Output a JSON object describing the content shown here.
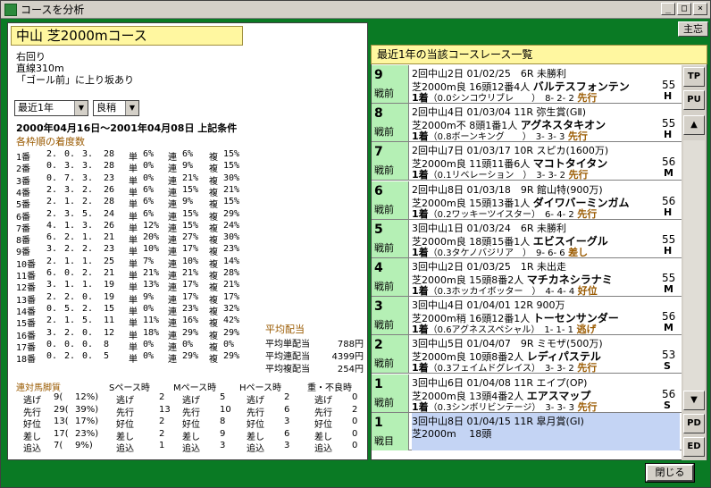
{
  "window": {
    "title": "コースを分析",
    "minimize": "_",
    "maximize": "□",
    "close": "×"
  },
  "shushi_label": "主忘",
  "course": {
    "title": "中山 芝2000mコース",
    "notes": [
      "右回り",
      "直線310m",
      "「ゴール前」に上り坂あり"
    ]
  },
  "filters": {
    "period": "最近1年",
    "condition": "良稍"
  },
  "date_range": "2000年04月16日～2001年04月08日 上記条件",
  "gate_section_title": "各枠順の着度数",
  "gate_stats": [
    {
      "gate": "1番",
      "a": "2.",
      "b": "0.",
      "c": "3.",
      "d": "28",
      "tan": "6%",
      "ren": "6%",
      "fuku": "15%"
    },
    {
      "gate": "2番",
      "a": "0.",
      "b": "3.",
      "c": "3.",
      "d": "28",
      "tan": "0%",
      "ren": "9%",
      "fuku": "15%"
    },
    {
      "gate": "3番",
      "a": "0.",
      "b": "7.",
      "c": "3.",
      "d": "23",
      "tan": "0%",
      "ren": "21%",
      "fuku": "30%"
    },
    {
      "gate": "4番",
      "a": "2.",
      "b": "3.",
      "c": "2.",
      "d": "26",
      "tan": "6%",
      "ren": "15%",
      "fuku": "21%"
    },
    {
      "gate": "5番",
      "a": "2.",
      "b": "1.",
      "c": "2.",
      "d": "28",
      "tan": "6%",
      "ren": "9%",
      "fuku": "15%"
    },
    {
      "gate": "6番",
      "a": "2.",
      "b": "3.",
      "c": "5.",
      "d": "24",
      "tan": "6%",
      "ren": "15%",
      "fuku": "29%"
    },
    {
      "gate": "7番",
      "a": "4.",
      "b": "1.",
      "c": "3.",
      "d": "26",
      "tan": "12%",
      "ren": "15%",
      "fuku": "24%"
    },
    {
      "gate": "8番",
      "a": "6.",
      "b": "2.",
      "c": "1.",
      "d": "21",
      "tan": "20%",
      "ren": "27%",
      "fuku": "30%"
    },
    {
      "gate": "9番",
      "a": "3.",
      "b": "2.",
      "c": "2.",
      "d": "23",
      "tan": "10%",
      "ren": "17%",
      "fuku": "23%"
    },
    {
      "gate": "10番",
      "a": "2.",
      "b": "1.",
      "c": "1.",
      "d": "25",
      "tan": "7%",
      "ren": "10%",
      "fuku": "14%"
    },
    {
      "gate": "11番",
      "a": "6.",
      "b": "0.",
      "c": "2.",
      "d": "21",
      "tan": "21%",
      "ren": "21%",
      "fuku": "28%"
    },
    {
      "gate": "12番",
      "a": "3.",
      "b": "1.",
      "c": "1.",
      "d": "19",
      "tan": "13%",
      "ren": "17%",
      "fuku": "21%"
    },
    {
      "gate": "13番",
      "a": "2.",
      "b": "2.",
      "c": "0.",
      "d": "19",
      "tan": "9%",
      "ren": "17%",
      "fuku": "17%"
    },
    {
      "gate": "14番",
      "a": "0.",
      "b": "5.",
      "c": "2.",
      "d": "15",
      "tan": "0%",
      "ren": "23%",
      "fuku": "32%"
    },
    {
      "gate": "15番",
      "a": "2.",
      "b": "1.",
      "c": "5.",
      "d": "11",
      "tan": "11%",
      "ren": "16%",
      "fuku": "42%"
    },
    {
      "gate": "16番",
      "a": "3.",
      "b": "2.",
      "c": "0.",
      "d": "12",
      "tan": "18%",
      "ren": "29%",
      "fuku": "29%"
    },
    {
      "gate": "17番",
      "a": "0.",
      "b": "0.",
      "c": "0.",
      "d": "8",
      "tan": "0%",
      "ren": "0%",
      "fuku": "0%"
    },
    {
      "gate": "18番",
      "a": "0.",
      "b": "2.",
      "c": "0.",
      "d": "5",
      "tan": "0%",
      "ren": "29%",
      "fuku": "29%"
    }
  ],
  "labels": {
    "tan": "単",
    "ren": "連",
    "fuku": "複"
  },
  "payout": {
    "title": "平均配当",
    "rows": [
      {
        "label": "平均単配当",
        "value": "788円"
      },
      {
        "label": "平均連配当",
        "value": "4399円"
      },
      {
        "label": "平均複配当",
        "value": "254円"
      }
    ]
  },
  "style": {
    "headers": [
      "連対馬脚質",
      "Sペース時",
      "Mペース時",
      "Hペース時",
      "重・不良時"
    ],
    "rows": [
      {
        "name": "逃げ",
        "total": "9(",
        "pct": "12%)",
        "s": "2",
        "m": "5",
        "h": "2",
        "w": "0"
      },
      {
        "name": "先行",
        "total": "29(",
        "pct": "39%)",
        "s": "13",
        "m": "10",
        "h": "6",
        "w": "2"
      },
      {
        "name": "好位",
        "total": "13(",
        "pct": "17%)",
        "s": "2",
        "m": "8",
        "h": "3",
        "w": "0"
      },
      {
        "name": "差し",
        "total": "17(",
        "pct": "23%)",
        "s": "2",
        "m": "9",
        "h": "6",
        "w": "0"
      },
      {
        "name": "追込",
        "total": "7(",
        "pct": "9%)",
        "s": "1",
        "m": "3",
        "h": "3",
        "w": "0"
      }
    ]
  },
  "races_header": "最近1年の当該コースレース一覧",
  "races": [
    {
      "ago": "9",
      "unit": "戦前",
      "l1": "2回中山2日 01/02/25　6R 未勝利",
      "l2": "芝2000m良 16頭12番4人",
      "horse": "バルテスフォンテン",
      "num": "55",
      "rank": "1着",
      "l3": "（0.0シンコウリブレ　　）　8- 2- 2",
      "style": "先行",
      "mark": "H"
    },
    {
      "ago": "8",
      "unit": "戦前",
      "l1": "2回中山4日 01/03/04 11R 弥生賞(GⅡ)",
      "l2": "芝2000m不 8頭1番1人",
      "horse": "アグネスタキオン",
      "num": "55",
      "rank": "1着",
      "l3": "（0.8ボーンキング　　）　3- 3- 3",
      "style": "先行",
      "mark": "H"
    },
    {
      "ago": "7",
      "unit": "戦前",
      "l1": "2回中山7日 01/03/17 10R スピカ(1600万)",
      "l2": "芝2000m良 11頭11番6人",
      "horse": "マコトタイタン",
      "num": "56",
      "rank": "1着",
      "l3": "（0.1リベレーション　）　3- 3- 2",
      "style": "先行",
      "mark": "M"
    },
    {
      "ago": "6",
      "unit": "戦前",
      "l1": "2回中山8日 01/03/18　9R 館山特(900万)",
      "l2": "芝2000m良 15頭13番1人",
      "horse": "ダイワバーミンガム",
      "num": "56",
      "rank": "1着",
      "l3": "（0.2ワッキーツイスター）　6- 4- 2",
      "style": "先行",
      "mark": "H"
    },
    {
      "ago": "5",
      "unit": "戦前",
      "l1": "3回中山1日 01/03/24　6R 未勝利",
      "l2": "芝2000m良 18頭15番1人",
      "horse": "エビスイーグル",
      "num": "55",
      "rank": "1着",
      "l3": "（0.3タケノバジリア　）　9- 6- 6",
      "style": "差し",
      "mark": "H"
    },
    {
      "ago": "4",
      "unit": "戦前",
      "l1": "3回中山2日 01/03/25　1R 未出走",
      "l2": "芝2000m良 15頭8番2人",
      "horse": "マチカネシラナミ",
      "num": "55",
      "rank": "1着",
      "l3": "（0.3ホッカイボッター　）　4- 4- 4",
      "style": "好位",
      "mark": "M"
    },
    {
      "ago": "3",
      "unit": "戦前",
      "l1": "3回中山4日 01/04/01 12R 900万",
      "l2": "芝2000m稍 16頭12番1人",
      "horse": "トーセンサンダー",
      "num": "56",
      "rank": "1着",
      "l3": "（0.6アグネススペシャル）　1- 1- 1",
      "style": "逃げ",
      "mark": "M"
    },
    {
      "ago": "2",
      "unit": "戦前",
      "l1": "3回中山5日 01/04/07　9R ミモザ(500万)",
      "l2": "芝2000m良 10頭8番2人",
      "horse": "レディパステル",
      "num": "53",
      "rank": "1着",
      "l3": "（0.3フェイムドグレイス）　3- 3- 2",
      "style": "先行",
      "mark": "S"
    },
    {
      "ago": "1",
      "unit": "戦前",
      "l1": "3回中山6日 01/04/08 11R エイプ(OP)",
      "l2": "芝2000m良 13頭4番2人",
      "horse": "エアスマップ",
      "num": "56",
      "rank": "1着",
      "l3": "（0.3シンボリビンテージ）　3- 3- 3",
      "style": "先行",
      "mark": "S"
    },
    {
      "ago": "1",
      "unit": "戦目",
      "l1": "3回中山8日 01/04/15 11R 皐月賞(GⅠ)",
      "l2": "芝2000m　 18頭",
      "horse": "",
      "num": "",
      "rank": "",
      "l3": "",
      "style": "",
      "mark": ""
    }
  ],
  "scroll": {
    "tp": "TP",
    "pu": "PU",
    "up": "▲",
    "down": "▼",
    "pd": "PD",
    "ed": "ED"
  },
  "close_button": "閉じる",
  "colors": {
    "frame": "#0a7a24",
    "accent_yellow": "#fff7a0",
    "ago_green": "#b5f0b5",
    "current_blue": "#c4d4f4",
    "style_brown": "#9a5a00"
  }
}
